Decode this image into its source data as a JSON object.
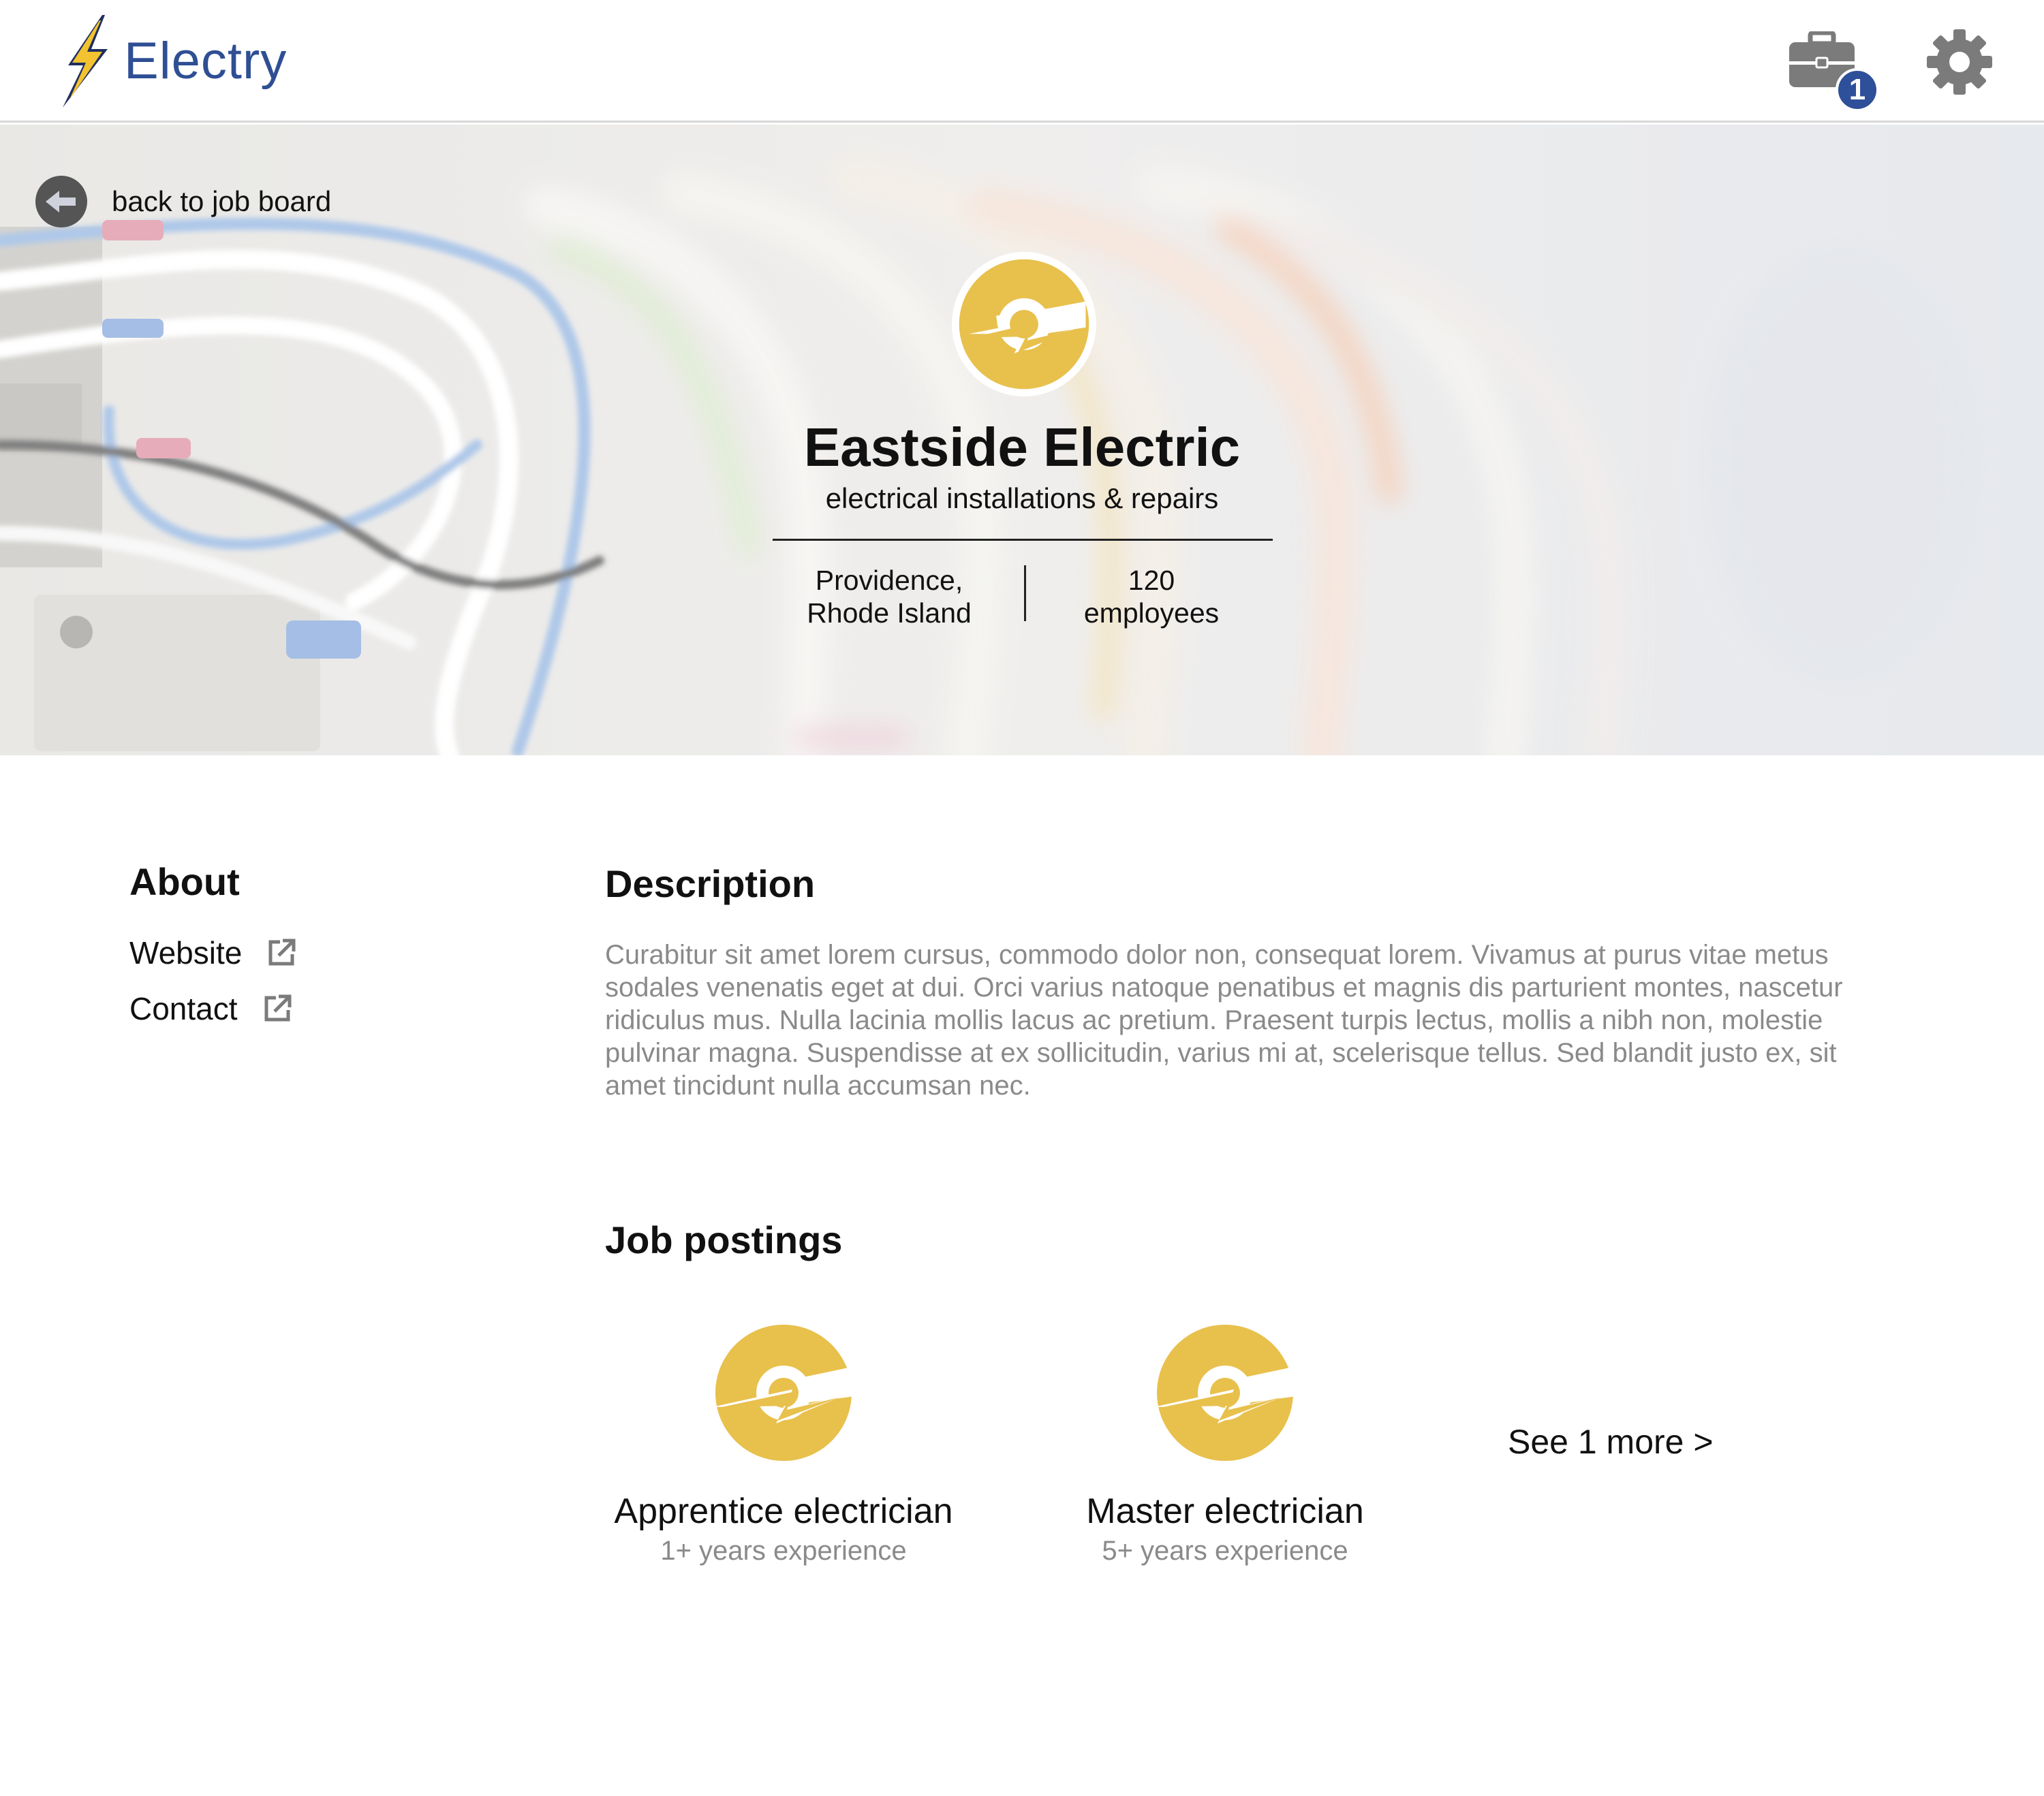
{
  "app": {
    "name": "Electry",
    "saved_jobs_count": "1"
  },
  "hero": {
    "back_label": "back to job board",
    "company_name": "Eastside Electric",
    "tagline": "electrical installations & repairs",
    "location_line1": "Providence,",
    "location_line2": "Rhode Island",
    "employees_count": "120",
    "employees_label": "employees"
  },
  "about": {
    "title": "About",
    "links": [
      {
        "label": "Website"
      },
      {
        "label": "Contact"
      }
    ]
  },
  "description": {
    "title": "Description",
    "text": "Curabitur sit amet lorem cursus, commodo dolor non, consequat lorem. Vivamus at purus vitae metus sodales venenatis eget at dui. Orci varius natoque penatibus et magnis dis parturient montes, nascetur ridiculus mus. Nulla lacinia mollis lacus ac pretium. Praesent turpis lectus, mollis a nibh non, molestie pulvinar magna. Suspendisse at ex sollicitudin, varius mi at, scelerisque tellus. Sed blandit justo ex, sit amet tincidunt nulla accumsan nec."
  },
  "jobs": {
    "title": "Job postings",
    "postings": [
      {
        "title": "Apprentice electrician",
        "experience": "1+ years experience"
      },
      {
        "title": "Master electrician",
        "experience": "5+ years experience"
      }
    ],
    "see_more": "See 1 more >"
  },
  "icons": {
    "brand": "lightning-bolt-icon",
    "jobs": "briefcase-icon",
    "settings": "gear-icon",
    "back": "arrow-left-icon",
    "external": "external-link-icon",
    "company_logo": "eastside-electric-logo"
  },
  "colors": {
    "brand_blue": "#2f4f94",
    "logo_yellow": "#e8c04c",
    "badge_blue": "#2e4f99",
    "muted_text": "#8a8a8a"
  }
}
